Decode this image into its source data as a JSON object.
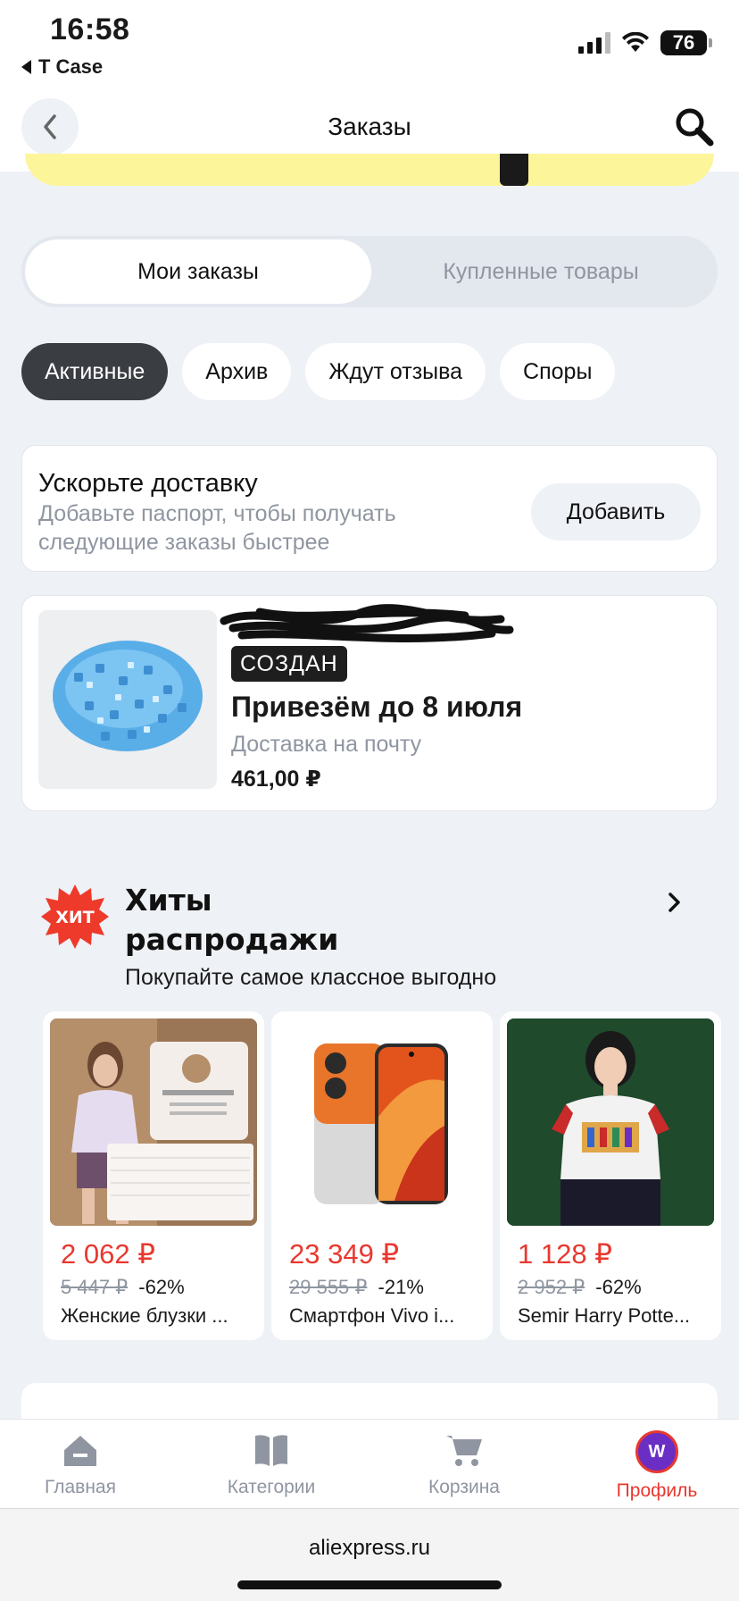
{
  "status_bar": {
    "time": "16:58",
    "back_app": "T Case",
    "battery": "76"
  },
  "header": {
    "title": "Заказы"
  },
  "segment": {
    "active": "Мои заказы",
    "inactive": "Купленные товары"
  },
  "filters": [
    {
      "label": "Активные",
      "active": true
    },
    {
      "label": "Архив",
      "active": false
    },
    {
      "label": "Ждут отзыва",
      "active": false
    },
    {
      "label": "Споры",
      "active": false
    }
  ],
  "promo": {
    "title": "Ускорьте доставку",
    "subtitle": "Добавьте паспорт, чтобы получать следующие заказы быстрее",
    "button": "Добавить"
  },
  "order": {
    "status": "СОЗДАН",
    "title": "Привезём до 8 июля",
    "delivery": "Доставка на почту",
    "price": "461,00 ₽"
  },
  "hits": {
    "badge": "ХИТ",
    "title": "Хиты распродажи",
    "subtitle": "Покупайте самое классное выгодно",
    "products": [
      {
        "price": "2 062 ₽",
        "old_price": "5 447 ₽",
        "discount": "-62%",
        "name": "Женские блузки ..."
      },
      {
        "price": "23 349 ₽",
        "old_price": "29 555 ₽",
        "discount": "-21%",
        "name": "Смартфон Vivo i..."
      },
      {
        "price": "1 128 ₽",
        "old_price": "2 952 ₽",
        "discount": "-62%",
        "name": "Semir Harry Potte..."
      }
    ]
  },
  "nav": {
    "home": "Главная",
    "categories": "Категории",
    "cart": "Корзина",
    "profile": "Профиль",
    "avatar_letter": "W"
  },
  "browser": {
    "url": "aliexpress.ru"
  },
  "colors": {
    "accent": "#e8382f",
    "background": "#eef1f5",
    "chip_active": "#3a3d42"
  },
  "icons": [
    "back-arrow-icon",
    "search-icon",
    "chevron-right-icon",
    "home-icon",
    "book-icon",
    "cart-icon"
  ]
}
